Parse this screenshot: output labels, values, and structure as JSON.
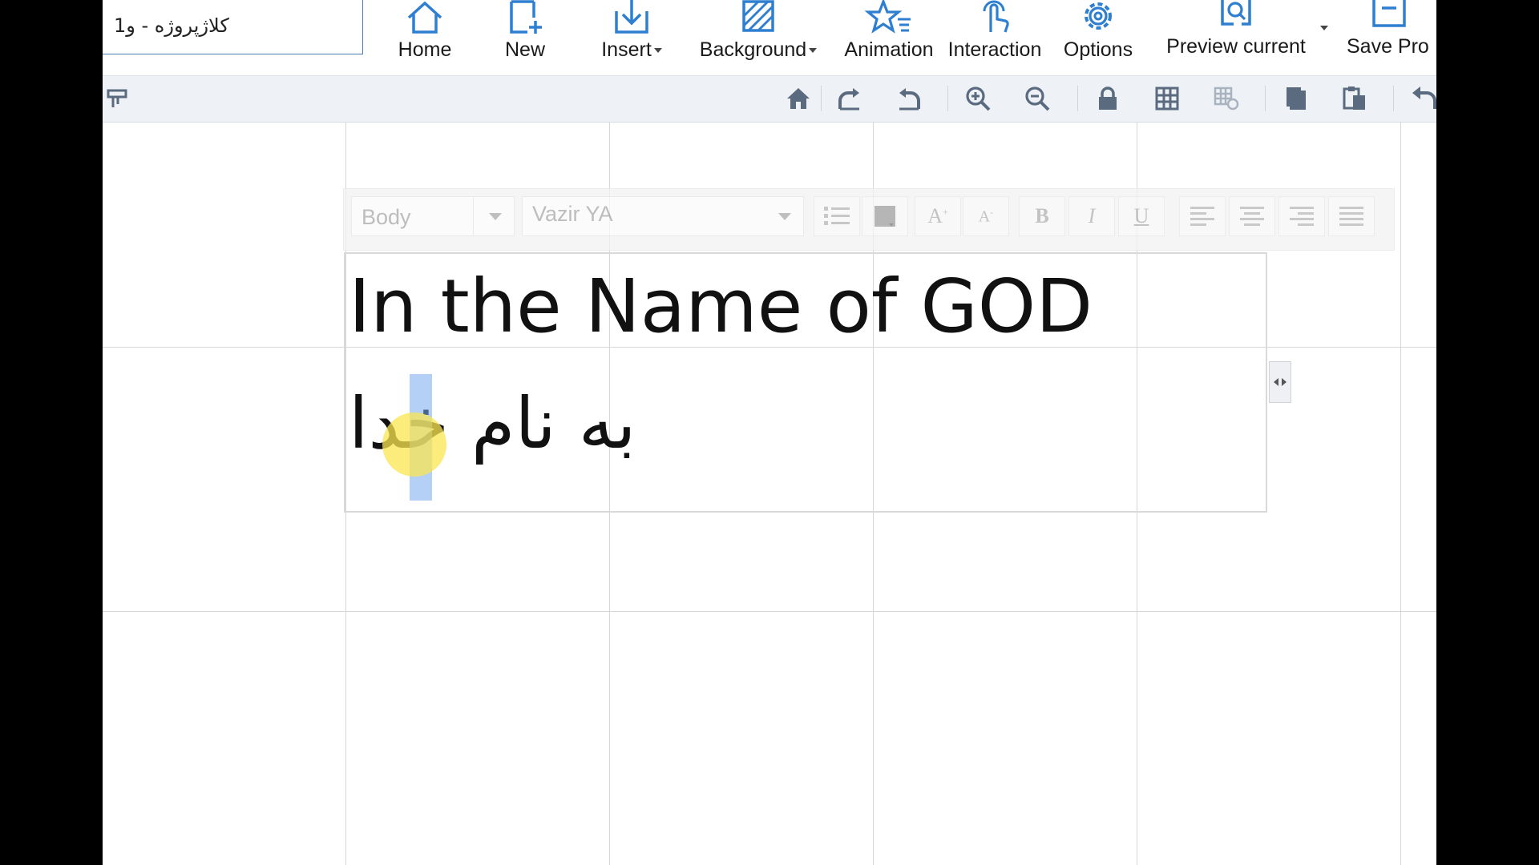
{
  "project": {
    "name": "کلاژپروژه - و1"
  },
  "ribbon": {
    "home": "Home",
    "new": "New",
    "insert": "Insert",
    "background": "Background",
    "animation": "Animation",
    "interaction": "Interaction",
    "options": "Options",
    "preview": "Preview current",
    "save": "Save Pro"
  },
  "format_bar": {
    "style": "Body",
    "font": "Vazir YA",
    "bold": "B",
    "italic": "I",
    "underline": "U"
  },
  "textbox": {
    "line1": "In the Name of GOD",
    "line2": "به نام خدا"
  },
  "colors": {
    "accent": "#2f7fd0",
    "selection": "#78aaf0",
    "cursor_highlight": "#fae650"
  }
}
